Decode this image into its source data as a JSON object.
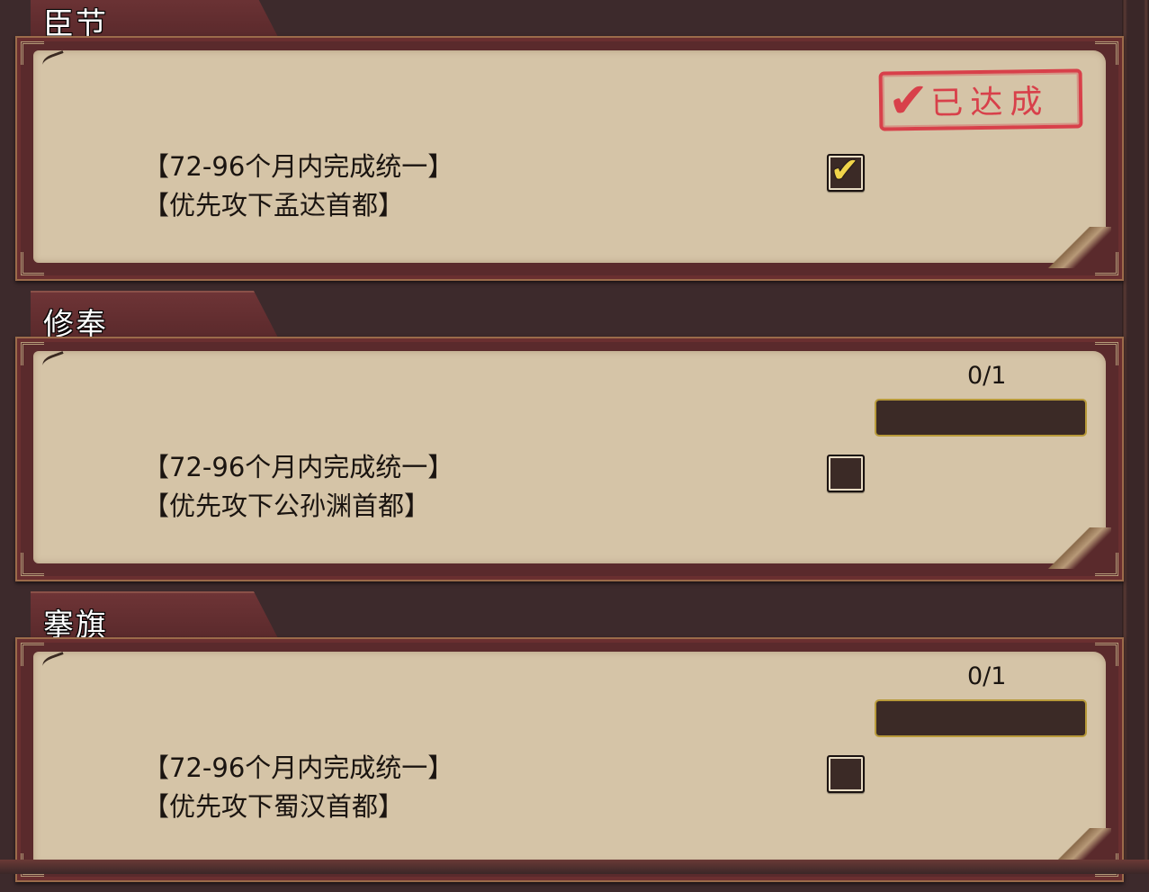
{
  "sections": [
    {
      "title": "臣节",
      "line1": "【72-96个月内完成统一】",
      "line2": "【优先攻下孟达首都】",
      "checked": true,
      "checkmark": "✔",
      "stamp_check": "✔",
      "stamp_text": "已达成"
    },
    {
      "title": "修奉",
      "line1": "【72-96个月内完成统一】",
      "line2": "【优先攻下公孙渊首都】",
      "checked": false,
      "progress_text": "0/1",
      "progress": 0
    },
    {
      "title": "搴旗",
      "line1": "【72-96个月内完成统一】",
      "line2": "【优先攻下蜀汉首都】",
      "checked": false,
      "progress_text": "0/1",
      "progress": 0
    }
  ],
  "colors": {
    "background": "#3d2a2c",
    "parchment": "#d5c4a7",
    "tab": "#6e3436",
    "stamp": "#d8404a",
    "checkmark": "#f0d44a",
    "progress_border": "#b89a3a"
  }
}
